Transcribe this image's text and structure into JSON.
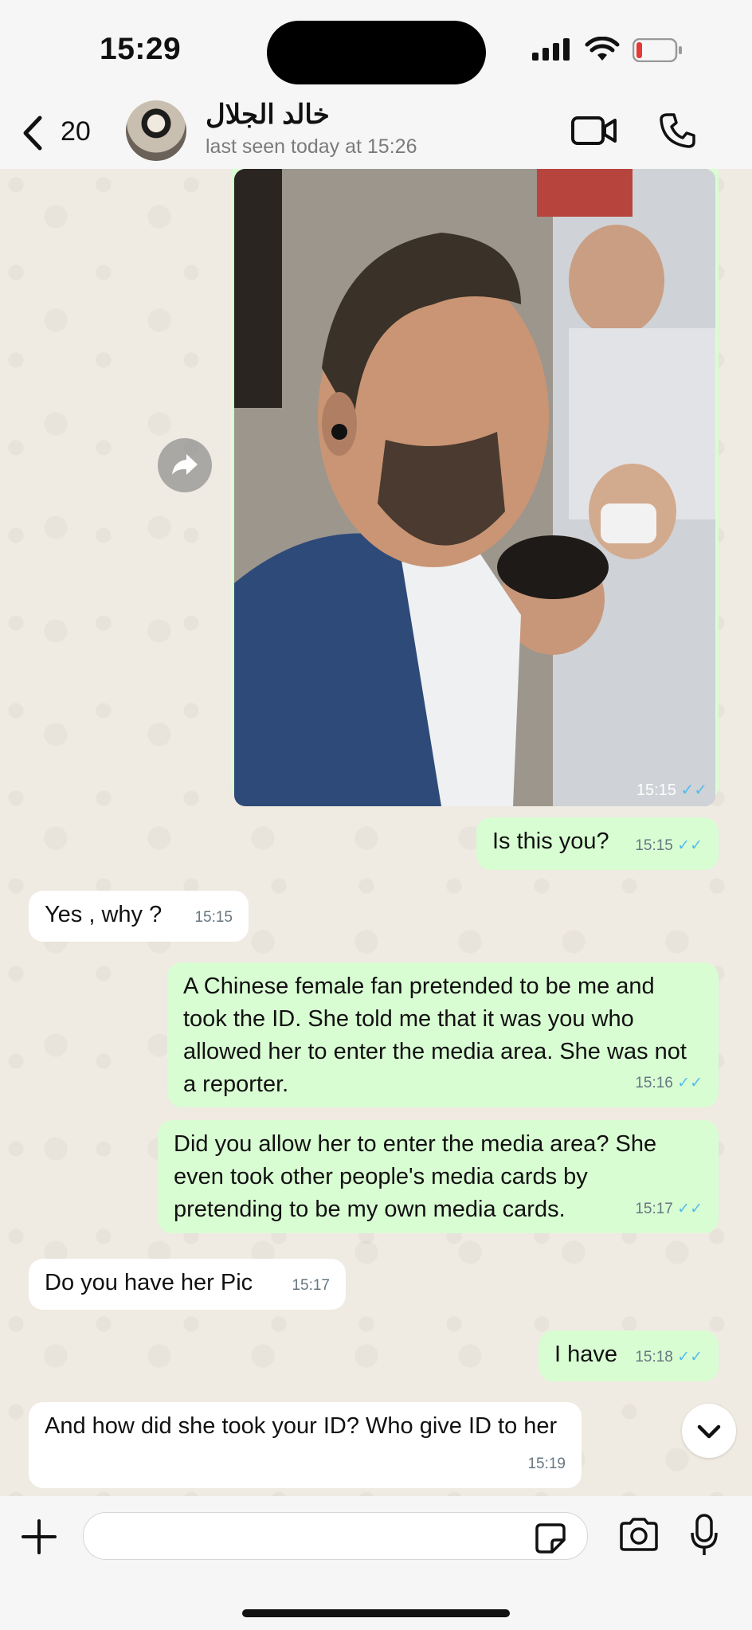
{
  "status": {
    "time": "15:29"
  },
  "header": {
    "unread_count": "20",
    "contact_name": "خالد الجلال",
    "last_seen": "last seen today at 15:26",
    "icons": [
      "chevron-left-icon",
      "video-call-icon",
      "phone-icon"
    ]
  },
  "photo_message": {
    "time": "15:15"
  },
  "messages": [
    {
      "dir": "out",
      "text": "Is this you?",
      "time": "15:15"
    },
    {
      "dir": "in",
      "text": "Yes , why ?",
      "time": "15:15"
    },
    {
      "dir": "out",
      "text": "A Chinese female fan pretended to be me and took the ID. She told me that it was you who allowed her to enter the media area. She was not a reporter.",
      "time": "15:16"
    },
    {
      "dir": "out",
      "text": "Did you allow her to enter the media area? She even took other people's media cards by pretending to be my own media cards.",
      "time": "15:17"
    },
    {
      "dir": "in",
      "text": "Do you have her Pic",
      "time": "15:17"
    },
    {
      "dir": "out",
      "text": "I have",
      "time": "15:18"
    },
    {
      "dir": "in",
      "text": "And how did she took your ID? Who give ID to her",
      "time": "15:19"
    }
  ],
  "composer": {
    "input_value": ""
  },
  "colors": {
    "outgoing": "#d9fdd3",
    "incoming": "#ffffff",
    "read_ticks": "#53bdeb",
    "background": "#efeae2"
  }
}
